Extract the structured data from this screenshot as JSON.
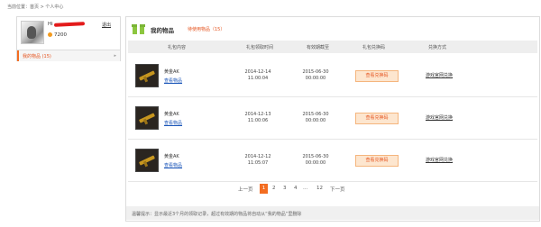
{
  "breadcrumb": "当前位置：首页 > 个人中心",
  "user": {
    "greeting": "Hi",
    "logout": "退出",
    "coins": "7200"
  },
  "sidebar": {
    "items": [
      {
        "label": "我的物品 (15)"
      }
    ],
    "arrow": "▸"
  },
  "header": {
    "title": "我的物品",
    "pending": "待使用物品（15）"
  },
  "table": {
    "columns": [
      "礼包内容",
      "礼包领取时间",
      "有效期截至",
      "礼包兑换码",
      "兑换方式"
    ],
    "rows": [
      {
        "name": "黄金AK",
        "view": "查看物品",
        "claim_date": "2014-12-14",
        "claim_time": "11:00:04",
        "expire_date": "2015-06-30",
        "expire_time": "00:00:00",
        "code_btn": "查看兑换码",
        "redeem": "游戏官网兑换"
      },
      {
        "name": "黄金AK",
        "view": "查看物品",
        "claim_date": "2014-12-13",
        "claim_time": "11:00:06",
        "expire_date": "2015-06-30",
        "expire_time": "00:00:00",
        "code_btn": "查看兑换码",
        "redeem": "游戏官网兑换"
      },
      {
        "name": "黄金AK",
        "view": "查看物品",
        "claim_date": "2014-12-12",
        "claim_time": "11:05:07",
        "expire_date": "2015-06-30",
        "expire_time": "00:00:00",
        "code_btn": "查看兑换码",
        "redeem": "游戏官网兑换"
      }
    ]
  },
  "pagination": {
    "prev": "上一页",
    "pages": [
      "1",
      "2",
      "3",
      "4",
      "...",
      "12"
    ],
    "next": "下一页",
    "current": "1"
  },
  "tip": "温馨提示：显示最近3个月的领取记录，超过有效期的物品将自动从“我的物品”里删除",
  "colors": {
    "accent": "#f36d21",
    "link": "#1a55b8",
    "gift": "#8cc63f"
  }
}
